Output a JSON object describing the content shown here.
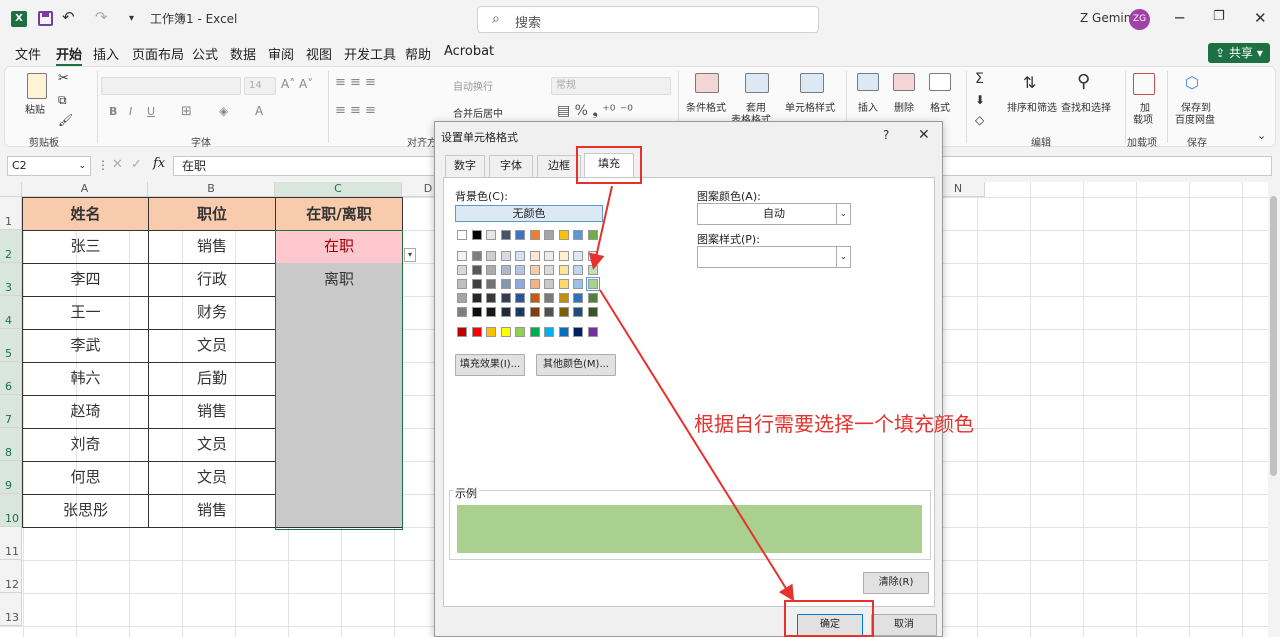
{
  "titlebar": {
    "title": "工作簿1 - Excel",
    "search_placeholder": "搜索",
    "user": "Z Gemini",
    "avatar": "ZG"
  },
  "menu": [
    "文件",
    "开始",
    "插入",
    "页面布局",
    "公式",
    "数据",
    "审阅",
    "视图",
    "开发工具",
    "帮助",
    "Acrobat"
  ],
  "share_label": "共享",
  "ribbon": {
    "paste": "粘贴",
    "clipboard": "剪贴板",
    "font_group": "字体",
    "align_group": "对齐方",
    "font_size": "14",
    "wrap": "自动换行",
    "merge": "合并后居中",
    "number_format": "常规",
    "cond_format": "条件格式",
    "table_format_1": "套用",
    "table_format_2": "表格格式",
    "cell_style": "单元格样式",
    "insert": "插入",
    "delete": "删除",
    "format": "格式",
    "sort": "排序和筛选",
    "find": "查找和选择",
    "edit_group": "编辑",
    "addin_1": "加",
    "addin_2": "载项",
    "addin_group": "加载项",
    "save_1": "保存到",
    "save_2": "百度网盘",
    "save_group": "保存"
  },
  "formula_bar": {
    "name_box": "C2",
    "fx": "fx",
    "value": "在职"
  },
  "columns": [
    "A",
    "B",
    "C",
    "D",
    "E",
    "F",
    "G",
    "H",
    "I",
    "J",
    "K",
    "L",
    "M",
    "N"
  ],
  "rows": [
    "1",
    "2",
    "3",
    "4",
    "5",
    "6",
    "7",
    "8",
    "9",
    "10",
    "11",
    "12",
    "13"
  ],
  "table": {
    "headers": [
      "姓名",
      "职位",
      "在职/离职"
    ],
    "rows": [
      [
        "张三",
        "销售",
        "在职"
      ],
      [
        "李四",
        "行政",
        "离职"
      ],
      [
        "王一",
        "财务",
        ""
      ],
      [
        "李武",
        "文员",
        ""
      ],
      [
        "韩六",
        "后勤",
        ""
      ],
      [
        "赵琦",
        "销售",
        ""
      ],
      [
        "刘奇",
        "文员",
        ""
      ],
      [
        "何思",
        "文员",
        ""
      ],
      [
        "张思彤",
        "销售",
        ""
      ]
    ]
  },
  "dialog": {
    "title": "设置单元格格式",
    "help": "?",
    "close": "✕",
    "tabs": [
      "数字",
      "字体",
      "边框",
      "填充"
    ],
    "bg_color_label": "背景色(C):",
    "no_color": "无颜色",
    "pattern_color_label": "图案颜色(A):",
    "pattern_color_value": "自动",
    "pattern_style_label": "图案样式(P):",
    "fill_effects": "填充效果(I)...",
    "more_colors": "其他颜色(M)...",
    "sample_label": "示例",
    "clear": "清除(R)",
    "ok": "确定",
    "cancel": "取消"
  },
  "annotation": "根据自行需要选择一个填充颜色",
  "colors": {
    "accent": "#1d7044",
    "header_fill": "#f8cbad",
    "pink_fill": "#ffc7ce",
    "gray_fill": "#c9c9c9",
    "sample_fill": "#a9d08e",
    "annotation": "#e5322d"
  }
}
